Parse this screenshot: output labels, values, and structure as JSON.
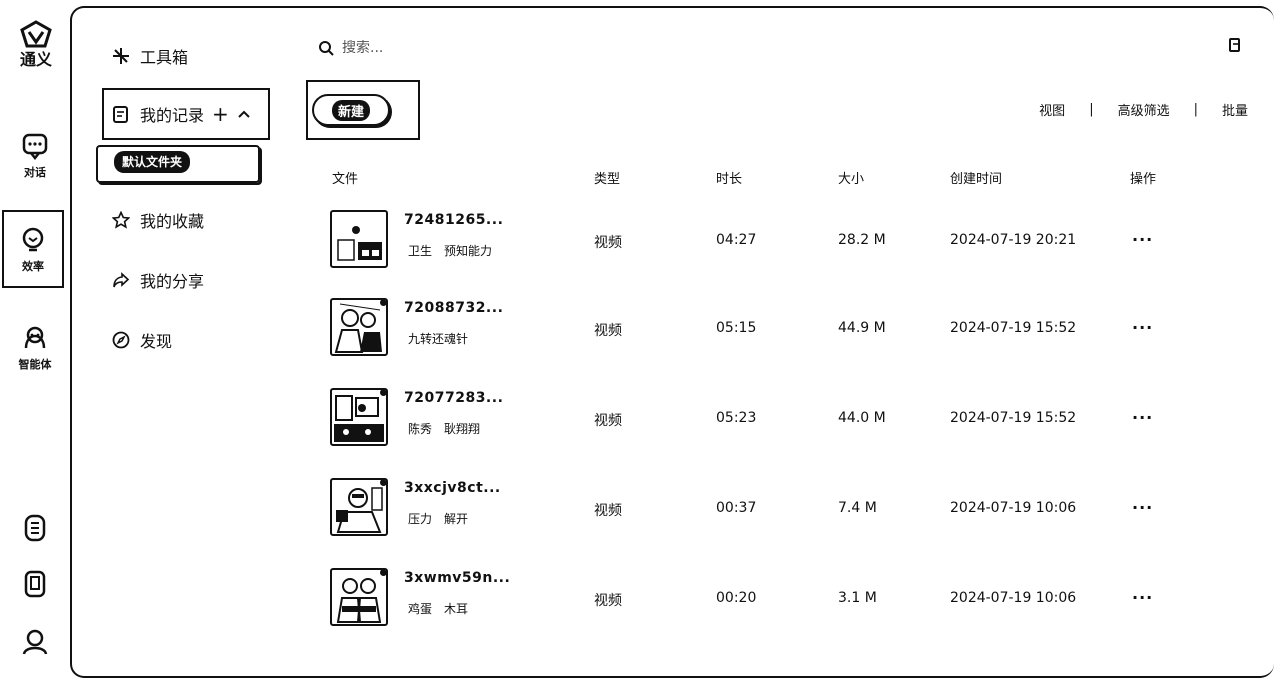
{
  "app": {
    "logo_text": "通义"
  },
  "rail": {
    "items": [
      {
        "label": "对话",
        "icon": "chat-icon"
      },
      {
        "label": "效率",
        "icon": "lightbulb-icon"
      },
      {
        "label": "智能体",
        "icon": "agent-icon"
      }
    ],
    "bottom_icons": [
      "document-icon",
      "phone-icon",
      "user-icon"
    ]
  },
  "nav": {
    "toolbox": "工具箱",
    "records": "我的记录",
    "records_add": "+",
    "default_folder": "默认文件夹",
    "favorites": "我的收藏",
    "shares": "我的分享",
    "discover": "发现"
  },
  "search": {
    "placeholder": "搜索..."
  },
  "actions": {
    "new_label": "新建"
  },
  "toolbar": {
    "view": "视图",
    "filter": "高级筛选",
    "batch": "批量"
  },
  "table": {
    "headers": {
      "file": "文件",
      "type": "类型",
      "duration": "时长",
      "size": "大小",
      "created": "创建时间",
      "ops": "操作"
    },
    "rows": [
      {
        "name": "72481265...",
        "tags": [
          "卫生",
          "预知能力"
        ],
        "type": "视频",
        "duration": "04:27",
        "size": "28.2 M",
        "created": "2024-07-19 20:21",
        "ops": "···"
      },
      {
        "name": "72088732...",
        "tags": [
          "九转还魂针"
        ],
        "type": "视频",
        "duration": "05:15",
        "size": "44.9 M",
        "created": "2024-07-19 15:52",
        "ops": "···"
      },
      {
        "name": "72077283...",
        "tags": [
          "陈秀",
          "耿翔翔"
        ],
        "type": "视频",
        "duration": "05:23",
        "size": "44.0 M",
        "created": "2024-07-19 15:52",
        "ops": "···"
      },
      {
        "name": "3xxcjv8ct...",
        "tags": [
          "压力",
          "解开"
        ],
        "type": "视频",
        "duration": "00:37",
        "size": "7.4 M",
        "created": "2024-07-19 10:06",
        "ops": "···"
      },
      {
        "name": "3xwmv59n...",
        "tags": [
          "鸡蛋",
          "木耳"
        ],
        "type": "视频",
        "duration": "00:20",
        "size": "3.1 M",
        "created": "2024-07-19 10:06",
        "ops": "···"
      }
    ]
  }
}
